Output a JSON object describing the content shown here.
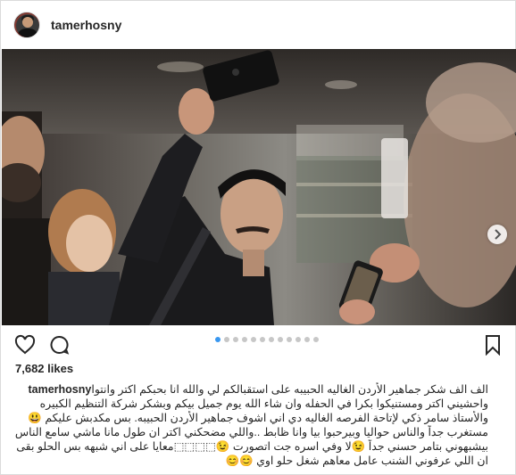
{
  "post": {
    "username": "tamerhosny",
    "likes": "7,682 likes",
    "carousel": {
      "total": 12,
      "active": 0
    },
    "caption_user": "tamerhosny",
    "caption_lines": [
      "الف الف شكر جماهير الأردن الغاليه الحبيبه على استقبالكم لي والله انا بحبكم اكتر وانتوا",
      "واحشيني اكتر ومستنيكوا بكرا في الحفله وان شاء الله يوم جميل بيكم وبشكر شركة التنظيم الكبيره",
      "والأستاذ سامر ذكي لإتاحة الفرصه الغاليه دي اني اشوف جماهير الأردن الحبيبه. بس مكدبش عليكم 😃",
      "مستغرب جداً والناس حواليا وبيرحبوا بيا وانا ظابط ..واللي مضحكني اكتر ان طول مانا ماشي سامع الناس",
      "بيشبهوني بتامر حسني جداً 😉لا وفي اسره جت اتصورت 😉⬚⬚⬚⬚معايا على اني شبهه بس الحلو بقى",
      "ان اللي عرفوني الشنب عامل معاهم شغل حلو اوي 😊😊"
    ]
  },
  "icons": {
    "like": "heart-icon",
    "comment": "comment-icon",
    "save": "bookmark-icon",
    "next": "chevron-right-icon"
  },
  "colors": {
    "accent": "#3897f0",
    "text": "#262626",
    "border": "#dbdbdb"
  }
}
